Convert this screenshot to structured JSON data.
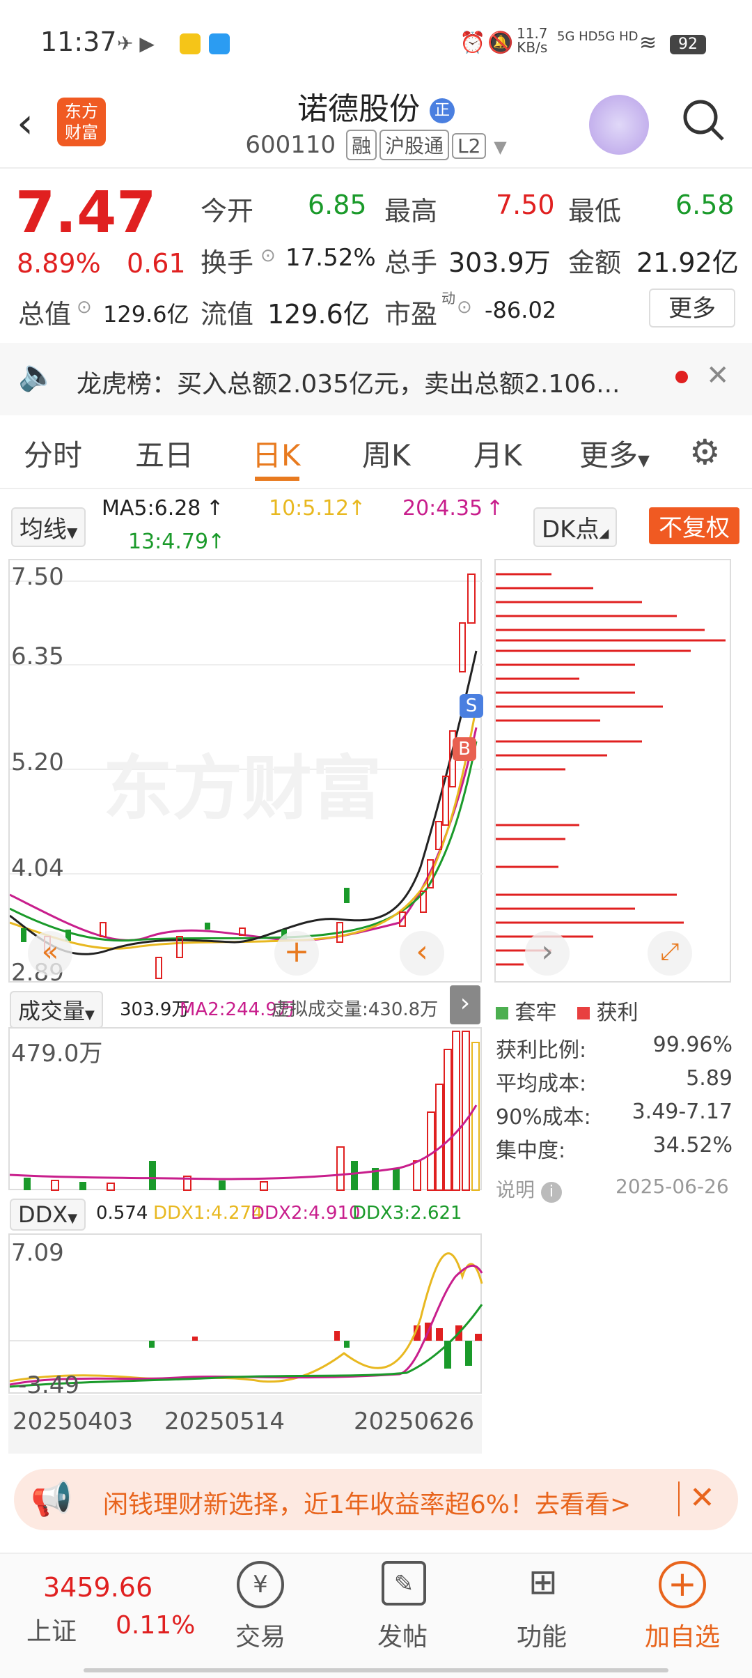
{
  "status": {
    "time": "11:37",
    "net_speed_top": "11.7",
    "net_speed_unit": "KB/s",
    "battery": "92",
    "sig1": "5G HD",
    "sig2": "5G HD"
  },
  "header": {
    "logo": "东方财富",
    "title": "诺德股份",
    "title_badge": "正",
    "code": "600110",
    "tags": [
      "融",
      "沪股通",
      "L2"
    ]
  },
  "quote": {
    "price": "7.47",
    "change_pct": "8.89%",
    "change": "0.61",
    "open_label": "今开",
    "open": "6.85",
    "high_label": "最高",
    "high": "7.50",
    "low_label": "最低",
    "low": "6.58",
    "turnover_label": "换手",
    "turnover": "17.52%",
    "volume_label": "总手",
    "volume": "303.9万",
    "amount_label": "金额",
    "amount": "21.92亿",
    "mktcap_label": "总值",
    "mktcap": "129.6亿",
    "float_label": "流值",
    "float_cap": "129.6亿",
    "pe_label": "市盈",
    "pe_sup": "动",
    "pe": "-86.02",
    "more": "更多"
  },
  "notice": {
    "text": "龙虎榜：买入总额2.035亿元，卖出总额2.106..."
  },
  "tabs": [
    {
      "label": "分时"
    },
    {
      "label": "五日"
    },
    {
      "label": "日K"
    },
    {
      "label": "周K"
    },
    {
      "label": "月K"
    },
    {
      "label": "更多"
    }
  ],
  "chart": {
    "ma_select": "均线",
    "ma5": "MA5:6.28",
    "ma10": "10:5.12",
    "ma20": "20:4.35",
    "ma13": "13:4.79",
    "dk_btn": "DK点",
    "fq_btn": "不复权",
    "yticks": [
      "7.50",
      "6.35",
      "5.20",
      "4.04",
      "2.89"
    ],
    "watermark": "东方财富",
    "marker_s": "S",
    "marker_b": "B",
    "vol_select": "成交量",
    "vol_val": "303.9万",
    "vol_ma2": "MA2:244.9万",
    "vol_virtual": "虚拟成交量:430.8万",
    "vol_max": "479.0万",
    "ddx_select": "DDX",
    "ddx_val": "0.574",
    "ddx1": "DDX1:4.274",
    "ddx2": "DDX2:4.910",
    "ddx3": "DDX3:2.621",
    "ddx_max": "7.09",
    "ddx_min": "-3.49",
    "dates": [
      "20250403",
      "20250514",
      "20250626"
    ],
    "colors": {
      "up": "#e02020",
      "down": "#1a9a2a",
      "ma5": "#222222",
      "ma10": "#e8b820",
      "ma20": "#c81e8c",
      "ma13": "#1a9a2a"
    }
  },
  "chip": {
    "legend_trap": "套牢",
    "legend_profit": "获利",
    "rows": [
      {
        "label": "获利比例:",
        "value": "99.96%"
      },
      {
        "label": "平均成本:",
        "value": "5.89"
      },
      {
        "label": "90%成本:",
        "value": "3.49-7.17"
      },
      {
        "label": "集中度:",
        "value": "34.52%"
      }
    ],
    "note": "说明",
    "date": "2025-06-26"
  },
  "promo": {
    "text": "闲钱理财新选择，近1年收益率超6%！去看看>"
  },
  "bottom": {
    "index_value": "3459.66",
    "index_name": "上证",
    "index_change": "0.11%",
    "items": [
      {
        "label": "交易"
      },
      {
        "label": "发帖"
      },
      {
        "label": "功能"
      },
      {
        "label": "加自选"
      }
    ]
  }
}
